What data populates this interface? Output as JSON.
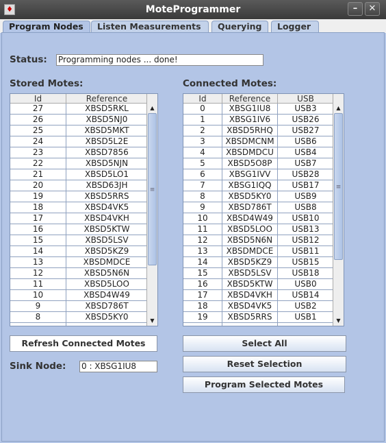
{
  "window": {
    "title": "MoteProgrammer",
    "minimize": "–",
    "close": "✕"
  },
  "tabs": [
    "Program Nodes",
    "Listen Measurements",
    "Querying",
    "Logger"
  ],
  "status": {
    "label": "Status:",
    "value": "Programming nodes ... done!"
  },
  "stored": {
    "title": "Stored Motes:",
    "columns": [
      "Id",
      "Reference"
    ],
    "rows": [
      [
        "27",
        "XBSD5RKL"
      ],
      [
        "26",
        "XBSD5NJ0"
      ],
      [
        "25",
        "XBSD5MKT"
      ],
      [
        "24",
        "XBSD5L2E"
      ],
      [
        "23",
        "XBSD7856"
      ],
      [
        "22",
        "XBSD5NJN"
      ],
      [
        "21",
        "XBSD5LO1"
      ],
      [
        "20",
        "XBSD63JH"
      ],
      [
        "19",
        "XBSD5RRS"
      ],
      [
        "18",
        "XBSD4VK5"
      ],
      [
        "17",
        "XBSD4VKH"
      ],
      [
        "16",
        "XBSD5KTW"
      ],
      [
        "15",
        "XBSD5LSV"
      ],
      [
        "14",
        "XBSD5KZ9"
      ],
      [
        "13",
        "XBSDMDCE"
      ],
      [
        "12",
        "XBSD5N6N"
      ],
      [
        "11",
        "XBSD5LOO"
      ],
      [
        "10",
        "XBSD4W49"
      ],
      [
        "9",
        "XBSD786T"
      ],
      [
        "8",
        "XBSD5KY0"
      ]
    ]
  },
  "connected": {
    "title": "Connected Motes:",
    "columns": [
      "Id",
      "Reference",
      "USB"
    ],
    "rows": [
      [
        "0",
        "XBSG1IU8",
        "USB3"
      ],
      [
        "1",
        "XBSG1IV6",
        "USB26"
      ],
      [
        "2",
        "XBSD5RHQ",
        "USB27"
      ],
      [
        "3",
        "XBSDMCNM",
        "USB6"
      ],
      [
        "4",
        "XBSDMDCU",
        "USB4"
      ],
      [
        "5",
        "XBSD5O8P",
        "USB7"
      ],
      [
        "6",
        "XBSG1IVV",
        "USB28"
      ],
      [
        "7",
        "XBSG1IQQ",
        "USB17"
      ],
      [
        "8",
        "XBSD5KY0",
        "USB9"
      ],
      [
        "9",
        "XBSD786T",
        "USB8"
      ],
      [
        "10",
        "XBSD4W49",
        "USB10"
      ],
      [
        "11",
        "XBSD5LOO",
        "USB13"
      ],
      [
        "12",
        "XBSD5N6N",
        "USB12"
      ],
      [
        "13",
        "XBSDMDCE",
        "USB11"
      ],
      [
        "14",
        "XBSD5KZ9",
        "USB15"
      ],
      [
        "15",
        "XBSD5LSV",
        "USB18"
      ],
      [
        "16",
        "XBSD5KTW",
        "USB0"
      ],
      [
        "17",
        "XBSD4VKH",
        "USB14"
      ],
      [
        "18",
        "XBSD4VK5",
        "USB2"
      ],
      [
        "19",
        "XBSD5RRS",
        "USB1"
      ]
    ]
  },
  "buttons": {
    "refresh": "Refresh Connected Motes",
    "select_all": "Select All",
    "reset": "Reset Selection",
    "program": "Program Selected Motes"
  },
  "sink": {
    "label": "Sink Node:",
    "value": "0 : XBSG1IU8"
  }
}
